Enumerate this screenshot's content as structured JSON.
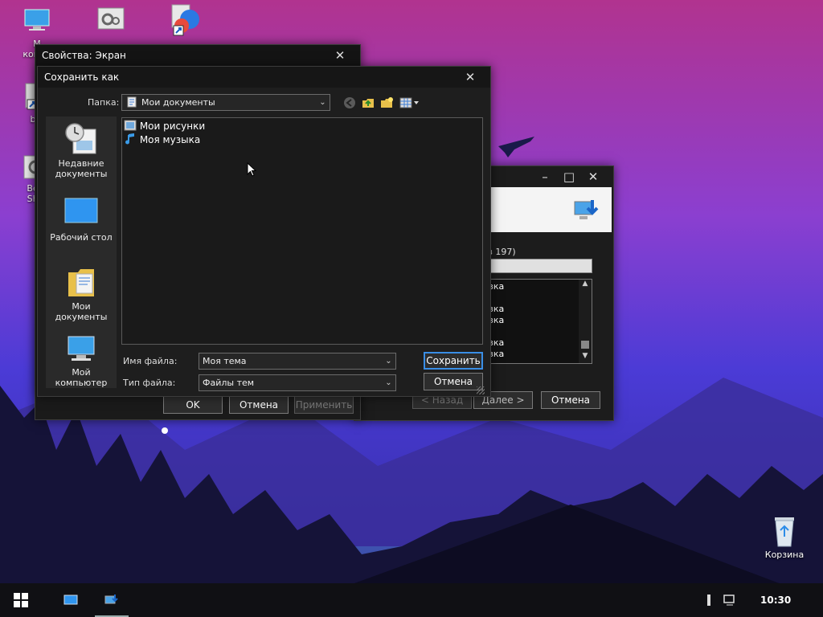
{
  "desktop": {
    "icons": [
      {
        "label": "M\nкомп",
        "icon": "computer-icon"
      },
      {
        "label": "",
        "icon": "settings-shortcut-icon"
      },
      {
        "label": "",
        "icon": "browser-shortcut-icon"
      },
      {
        "label": "bL",
        "icon": "shortcut-icon"
      },
      {
        "label": "Вер\nShe",
        "icon": "settings-shortcut-icon"
      },
      {
        "label": "Корзина",
        "icon": "recycle-bin-icon"
      }
    ]
  },
  "display_props": {
    "title": "Свойства: Экран",
    "ok": "OK",
    "cancel": "Отмена",
    "apply": "Применить"
  },
  "wizard": {
    "progress_text": "з 197)",
    "list_items": [
      "зка",
      "зка",
      "зка",
      "зка",
      "зка"
    ],
    "back": "< Назад",
    "next": "Далее >",
    "cancel": "Отмена"
  },
  "save_dialog": {
    "title": "Сохранить как",
    "folder_label": "Папка:",
    "folder_value": "Мои документы",
    "places": [
      {
        "label": "Недавние документы",
        "icon": "recent-documents-icon"
      },
      {
        "label": "Рабочий стол",
        "icon": "desktop-icon"
      },
      {
        "label": "Мои документы",
        "icon": "my-documents-icon"
      },
      {
        "label": "Мой компьютер",
        "icon": "my-computer-icon"
      }
    ],
    "files": [
      {
        "name": "Мои рисунки",
        "icon": "pictures-folder-icon"
      },
      {
        "name": "Моя музыка",
        "icon": "music-folder-icon"
      }
    ],
    "filename_label": "Имя файла:",
    "filename_value": "Моя тема",
    "filetype_label": "Тип файла:",
    "filetype_value": "Файлы тем",
    "save": "Сохранить",
    "cancel": "Отмена"
  },
  "taskbar": {
    "clock": "10:30"
  }
}
